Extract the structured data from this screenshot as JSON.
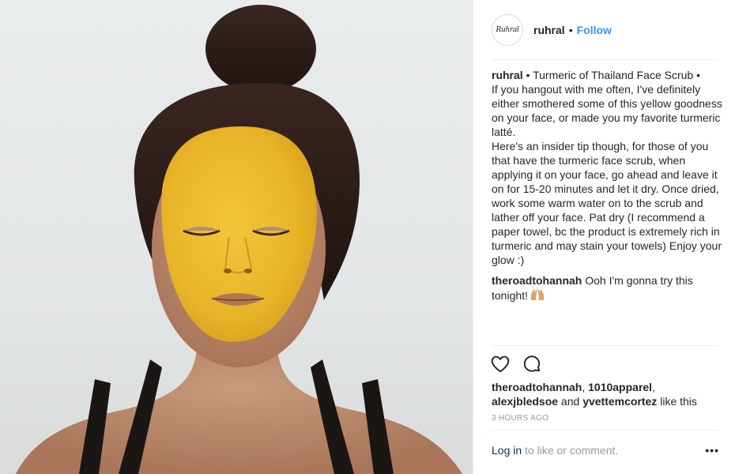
{
  "post": {
    "author": "ruhral",
    "follow_label": "Follow",
    "separator": "•",
    "avatar_text": "Ruhral"
  },
  "caption": {
    "username": "ruhral",
    "text": "• Turmeric of Thailand Face Scrub •\nIf you hangout with me often, I've definitely either smothered some of this yellow goodness on your face, or made you my favorite turmeric latté.\nHere's an insider tip though, for those of you that have the turmeric face scrub, when applying it on your face, go ahead and leave it on for 15-20 minutes and let it dry. Once dried, work some warm water on to the scrub and lather off your face. Pat dry (I recommend a paper towel, bc the product is extremely rich in turmeric and may stain your towels) Enjoy your glow :)"
  },
  "comments": [
    {
      "username": "theroadtohannah",
      "text": "Ooh I'm gonna try this tonight!",
      "emoji": "raising-hands-emoji"
    }
  ],
  "likes": {
    "user1": "theroadtohannah",
    "sep1": ", ",
    "user2": "1010apparel",
    "sep2": ",",
    "user3": "alexjbledsoe",
    "and": " and ",
    "user4": "yvettemcortez",
    "suffix": " like this"
  },
  "timestamp": "3 HOURS AGO",
  "footer": {
    "login_label": "Log in",
    "rest_text": " to like or comment.",
    "more_label": "•••"
  },
  "icons": {
    "like": "heart-icon",
    "comment": "comment-icon",
    "more": "more-options-icon"
  },
  "colors": {
    "follow": "#3897f0",
    "login_link": "#003569",
    "muted": "#999999",
    "text": "#262626",
    "mask": "#f0c030"
  }
}
